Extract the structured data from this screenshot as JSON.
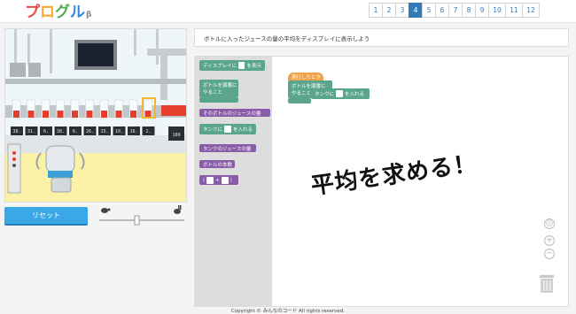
{
  "app": {
    "logo_text": "プログル",
    "logo_beta": "β"
  },
  "pages": {
    "items": [
      "1",
      "2",
      "3",
      "4",
      "5",
      "6",
      "7",
      "8",
      "9",
      "10",
      "11",
      "12"
    ],
    "active": "4"
  },
  "instruction": "ボトルに入ったジュースの量の平均をディスプレイに表示しよう",
  "reset_label": "リセット",
  "display_values": [
    "38.",
    "31.",
    "6.",
    "38.",
    "6.",
    "26.",
    "15.",
    "10.",
    "16.",
    "2."
  ],
  "counter_value": "100",
  "toolbox": {
    "display_block": "ディスプレイに",
    "display_block_suffix": "を表示",
    "repeat_block_line1": "ボトルを順番に",
    "repeat_block_line2": "やること",
    "juice_amount_block": "そのボトルのジュースの量",
    "tank_block_prefix": "タンクに",
    "tank_block_suffix": "を入れる",
    "tank_juice_block": "タンクのジュースの量",
    "bottle_count_block": "ボトルの本数",
    "add_block": "+"
  },
  "workspace": {
    "hat_label": "実行したとき",
    "repeat_line1": "ボトルを順番に",
    "repeat_line2": "やること",
    "inner_prefix": "タンクに",
    "inner_suffix": "を入れる"
  },
  "caption": "平均を求める！",
  "footer": "Copyright © みんなのコード All rights reserved.",
  "colors": {
    "accent": "#337ab7",
    "green_block": "#5ba58c",
    "purple_block": "#8a5ca8",
    "orange_hat": "#f0a24a",
    "reset": "#3aa7e6"
  }
}
